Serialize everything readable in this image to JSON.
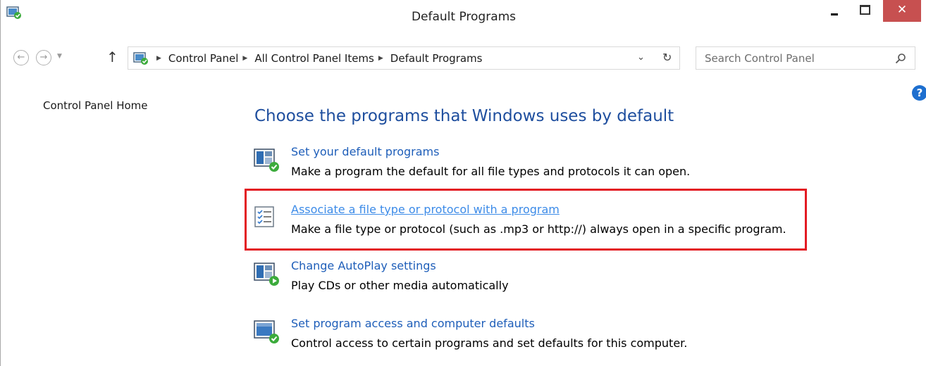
{
  "window": {
    "title": "Default Programs",
    "close_glyph": "✕"
  },
  "address_bar": {
    "breadcrumbs": [
      "Control Panel",
      "All Control Panel Items",
      "Default Programs"
    ],
    "search_placeholder": "Search Control Panel"
  },
  "nav": {
    "home": "Control Panel Home"
  },
  "main": {
    "heading": "Choose the programs that Windows uses by default",
    "tasks": [
      {
        "title": "Set your default programs",
        "description": "Make a program the default for all file types and protocols it can open.",
        "icon": "default-programs-icon"
      },
      {
        "title": "Associate a file type or protocol with a program",
        "description": "Make a file type or protocol (such as .mp3 or http://) always open in a specific program.",
        "icon": "checklist-icon",
        "highlighted": true
      },
      {
        "title": "Change AutoPlay settings",
        "description": "Play CDs or other media automatically",
        "icon": "autoplay-icon"
      },
      {
        "title": "Set program access and computer defaults",
        "description": "Control access to certain programs and set defaults for this computer.",
        "icon": "program-access-icon"
      }
    ]
  },
  "colors": {
    "link": "#1e5eb9",
    "heading": "#1e4e9e",
    "highlight_border": "#e31b23",
    "close_button": "#c75050"
  }
}
